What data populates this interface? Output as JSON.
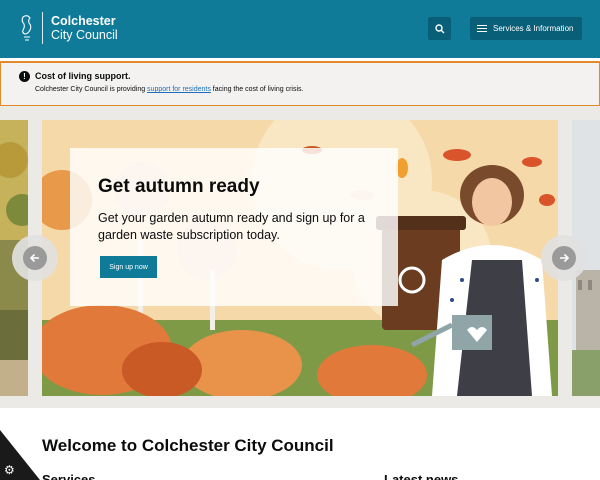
{
  "header": {
    "logo_line1": "Colchester",
    "logo_line2": "City Council",
    "menu_label": "Services & Information",
    "brand_color": "#0f7b99"
  },
  "alert": {
    "icon": "!",
    "title": "Cost of living support.",
    "text_before": "Colchester City Council is providing ",
    "link": "support for residents",
    "text_after": " facing the cost of living crisis.",
    "border_color": "#e08a2b"
  },
  "carousel": {
    "title": "Get autumn ready",
    "text": "Get your garden autumn ready and sign up for a garden waste subscription today.",
    "cta": "Sign up now",
    "prev_icon": "arrow-left-icon",
    "next_icon": "arrow-right-icon"
  },
  "welcome": {
    "title": "Welcome to Colchester City Council",
    "services_heading": "Services",
    "news_heading": "Latest news"
  },
  "cookie": {
    "icon": "gear-icon"
  }
}
